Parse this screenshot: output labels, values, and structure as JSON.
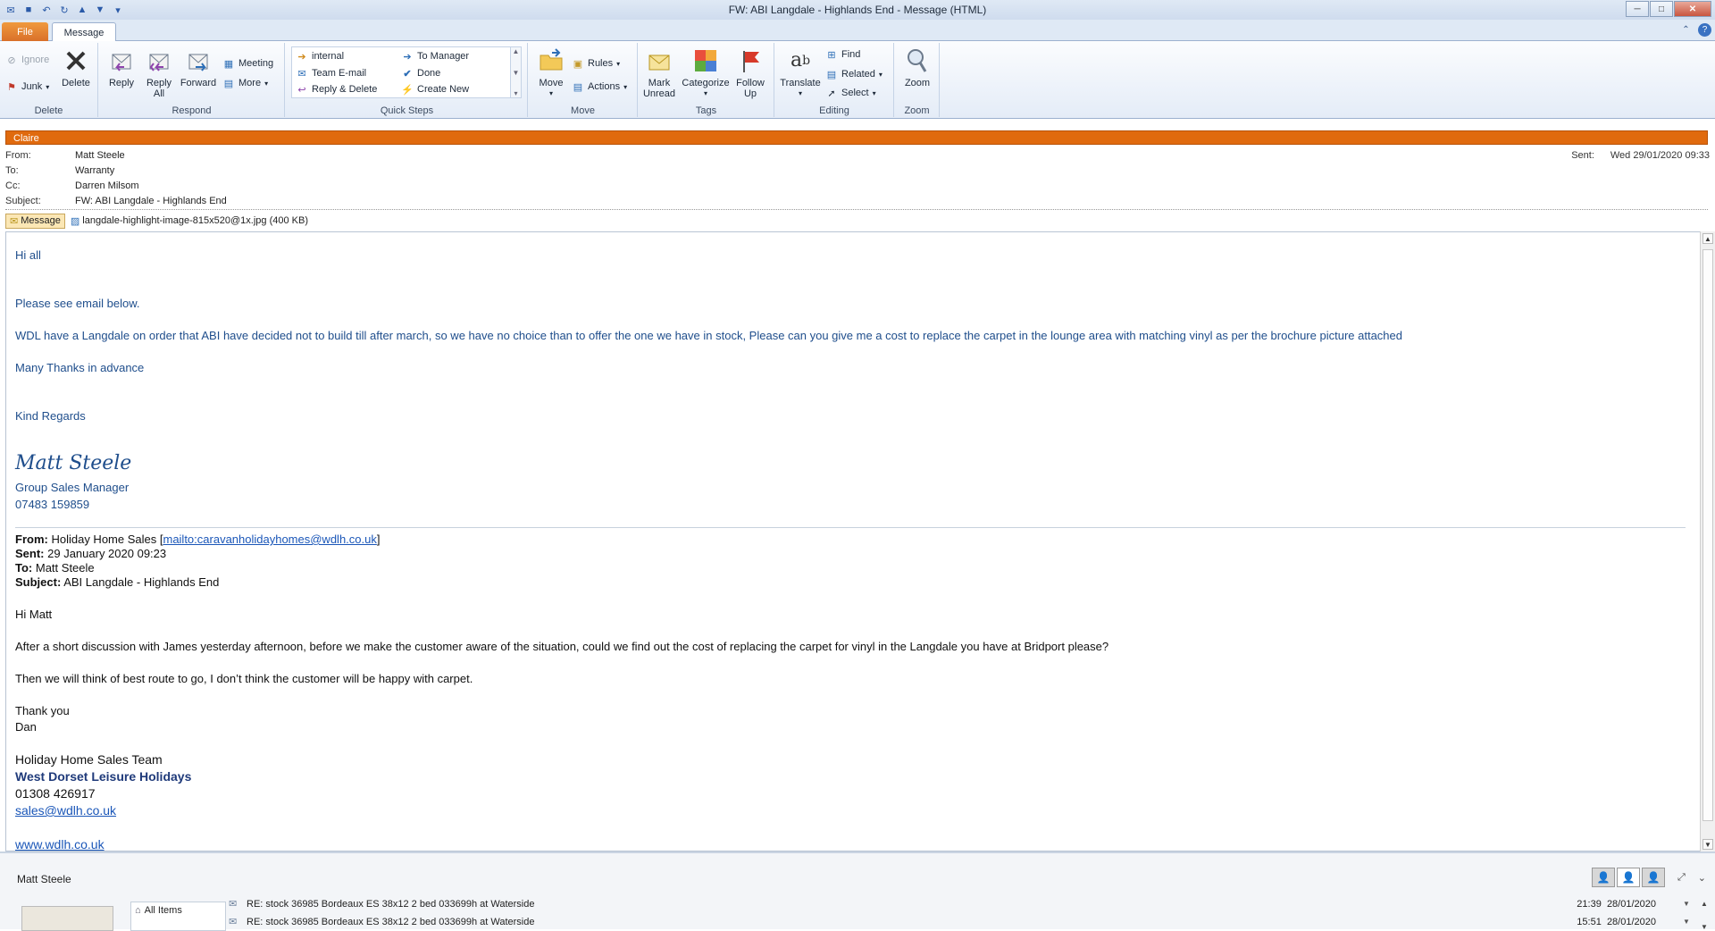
{
  "window": {
    "title": "FW: ABI Langdale - Highlands End  -  Message (HTML)",
    "minimize": "─",
    "maximize": "□",
    "close": "✕"
  },
  "tabs": {
    "file": "File",
    "message": "Message"
  },
  "ribbon": {
    "delete_group": {
      "label": "Delete",
      "ignore": "Ignore",
      "junk": "Junk",
      "delete": "Delete"
    },
    "respond_group": {
      "label": "Respond",
      "reply": "Reply",
      "reply_all_1": "Reply",
      "reply_all_2": "All",
      "forward": "Forward",
      "meeting": "Meeting",
      "more": "More"
    },
    "quick_steps": {
      "label": "Quick Steps",
      "items": [
        "internal",
        "To Manager",
        "Team E-mail",
        "Done",
        "Reply & Delete",
        "Create New"
      ]
    },
    "move_group": {
      "label": "Move",
      "move": "Move",
      "rules": "Rules",
      "actions": "Actions"
    },
    "tags_group": {
      "label": "Tags",
      "mark_unread_1": "Mark",
      "mark_unread_2": "Unread",
      "categorize": "Categorize",
      "follow_up_1": "Follow",
      "follow_up_2": "Up"
    },
    "editing_group": {
      "label": "Editing",
      "translate": "Translate",
      "find": "Find",
      "related": "Related",
      "select": "Select"
    },
    "zoom_group": {
      "label": "Zoom",
      "zoom": "Zoom"
    }
  },
  "header": {
    "category": "Claire",
    "from_label": "From:",
    "from": "Matt Steele",
    "to_label": "To:",
    "to": "Warranty",
    "cc_label": "Cc:",
    "cc": "Darren Milsom",
    "subject_label": "Subject:",
    "subject": "FW: ABI Langdale - Highlands End",
    "sent_label": "Sent:",
    "sent": "Wed 29/01/2020 09:33"
  },
  "attachments": {
    "message_tab": "Message",
    "file": "langdale-highlight-image-815x520@1x.jpg (400 KB)"
  },
  "body": {
    "greeting": "Hi all",
    "p1": "Please see email below.",
    "p2": "WDL have a Langdale on order that ABI have decided not to build till after march, so we have no choice than to offer the one we have in stock,   Please can you give me a cost to replace the carpet in the lounge area with matching vinyl as per the brochure picture attached",
    "p3": "Many Thanks in advance",
    "closing": "Kind Regards",
    "sig_name": "Matt Steele",
    "sig_title": "Group Sales Manager",
    "sig_phone": "07483 159859",
    "fwd": {
      "from_label": "From:",
      "from": "Holiday Home Sales",
      "from_email": "mailto:caravanholidayhomes@wdlh.co.uk",
      "sent_label": "Sent:",
      "sent": "29 January 2020 09:23",
      "to_label": "To:",
      "to": "Matt Steele",
      "subject_label": "Subject:",
      "subject": "ABI Langdale - Highlands End",
      "greeting": "Hi Matt",
      "p1": "After a short discussion with James yesterday afternoon, before we make the customer aware of the situation, could we find out the cost of replacing the carpet for vinyl in the Langdale you have at Bridport please?",
      "p2": "Then we will think of best route to go, I don’t think the customer will be happy with carpet.",
      "thanks": "Thank you",
      "name": "Dan",
      "team": "Holiday Home Sales Team",
      "company": "West Dorset Leisure Holidays",
      "phone": "01308 426917",
      "email": "sales@wdlh.co.uk",
      "website": "www.wdlh.co.uk"
    }
  },
  "people_pane": {
    "name": "Matt Steele",
    "all_items": "All Items",
    "items": [
      {
        "subject": "RE: stock 36985 Bordeaux ES 38x12 2 bed 033699h at Waterside",
        "time": "21:39",
        "date": "28/01/2020"
      },
      {
        "subject": "RE: stock 36985 Bordeaux ES 38x12 2 bed 033699h at Waterside",
        "time": "15:51",
        "date": "28/01/2020"
      }
    ]
  }
}
